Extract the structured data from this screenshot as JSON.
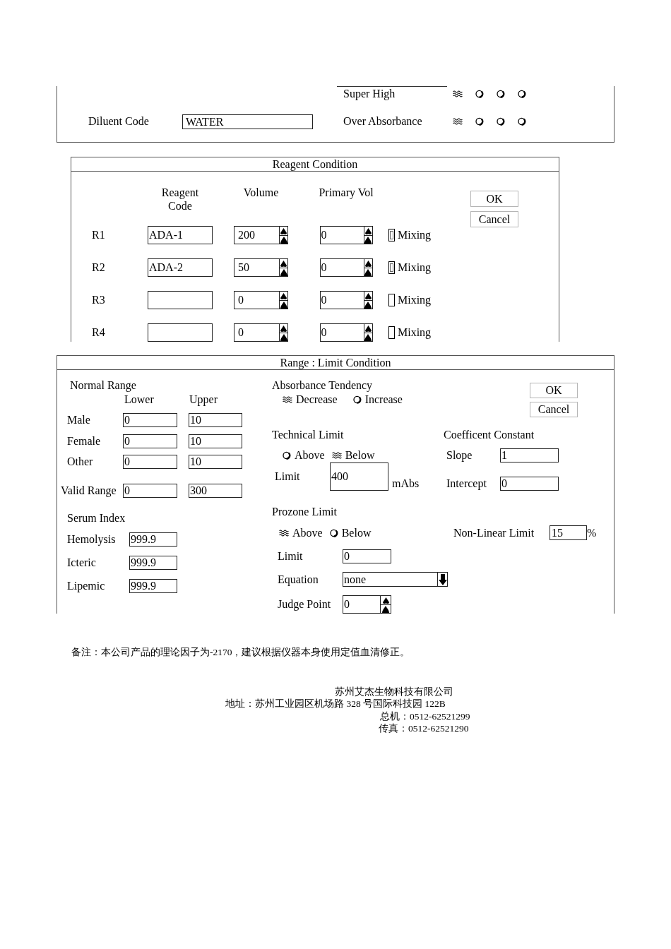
{
  "diluent_panel": {
    "absorbance_checks": [
      {
        "label": "Super High",
        "options": [
          {
            "selected": true
          },
          {
            "selected": false
          },
          {
            "selected": false
          },
          {
            "selected": false
          }
        ]
      },
      {
        "label": "Over Absorbance",
        "options": [
          {
            "selected": true
          },
          {
            "selected": false
          },
          {
            "selected": false
          },
          {
            "selected": false
          }
        ]
      }
    ],
    "diluent_code": {
      "label": "Diluent Code",
      "value": "WATER"
    }
  },
  "reagent_condition": {
    "title": "Reagent Condition",
    "columns": [
      "Reagent Code",
      "Volume",
      "Primary Vol"
    ],
    "buttons": [
      "OK",
      "Cancel"
    ],
    "rows": [
      {
        "label": "R1",
        "code": "ADA-1",
        "volume": "200",
        "primary_vol": "0",
        "mixing": {
          "label": "Mixing",
          "checked": true
        }
      },
      {
        "label": "R2",
        "code": "ADA-2",
        "volume": "50",
        "primary_vol": "0",
        "mixing": {
          "label": "Mixing",
          "checked": true
        }
      },
      {
        "label": "R3",
        "volume": "0",
        "primary_vol": "0",
        "mixing": {
          "label": "Mixing",
          "checked": false
        }
      },
      {
        "label": "R4",
        "volume": "0",
        "primary_vol": "0",
        "mixing": {
          "label": "Mixing",
          "checked": false
        }
      }
    ]
  },
  "range_limit_condition": {
    "title": "Range : Limit Condition",
    "buttons": [
      "OK",
      "Cancel"
    ],
    "normal_range": {
      "title": "Normal Range",
      "columns": [
        "Lower",
        "Upper"
      ],
      "rows": [
        {
          "label": "Male",
          "lower": "0",
          "upper": "10"
        },
        {
          "label": "Female",
          "lower": "0",
          "upper": "10"
        },
        {
          "label": "Other",
          "lower": "0",
          "upper": "10"
        }
      ],
      "valid_range": {
        "label": "Valid Range",
        "lower": "0",
        "upper": "300"
      }
    },
    "serum_index": {
      "title": "Serum Index",
      "rows": [
        {
          "label": "Hemolysis",
          "value": "999.9"
        },
        {
          "label": "Icteric",
          "value": "999.9"
        },
        {
          "label": "Lipemic",
          "value": "999.9"
        }
      ]
    },
    "absorbance_tendency": {
      "title": "Absorbance Tendency",
      "options": [
        {
          "label": "Decrease",
          "selected": true
        },
        {
          "label": "Increase",
          "selected": false
        }
      ]
    },
    "technical_limit": {
      "title": "Technical Limit",
      "options": [
        {
          "label": "Above",
          "selected": false
        },
        {
          "label": "Below",
          "selected": true
        }
      ],
      "limit": {
        "label": "Limit",
        "value": "400",
        "unit": "mAbs"
      }
    },
    "coefficient_constant": {
      "title": "Coefficent Constant",
      "slope": {
        "label": "Slope",
        "value": "1"
      },
      "intercept": {
        "label": "Intercept",
        "value": "0"
      }
    },
    "prozone_limit": {
      "title": "Prozone Limit",
      "options": [
        {
          "label": "Above",
          "selected": true
        },
        {
          "label": "Below",
          "selected": false
        }
      ],
      "limit": {
        "label": "Limit",
        "value": "0"
      },
      "equation": {
        "label": "Equation",
        "value": "none"
      },
      "judge_point": {
        "label": "Judge Point",
        "value": "0"
      }
    },
    "non_linear_limit": {
      "label": "Non-Linear Limit",
      "value": "15",
      "unit": "%"
    }
  },
  "note": "备注：本公司产品的理论因子为-2170，建议根据仪器本身使用定值血清修正。",
  "company": {
    "name": "苏州艾杰生物科技有限公司",
    "address": "地址：苏州工业园区机场路 328 号国际科技园 122B",
    "phone": "总机：0512-62521299",
    "fax": "传真：0512-62521290"
  }
}
